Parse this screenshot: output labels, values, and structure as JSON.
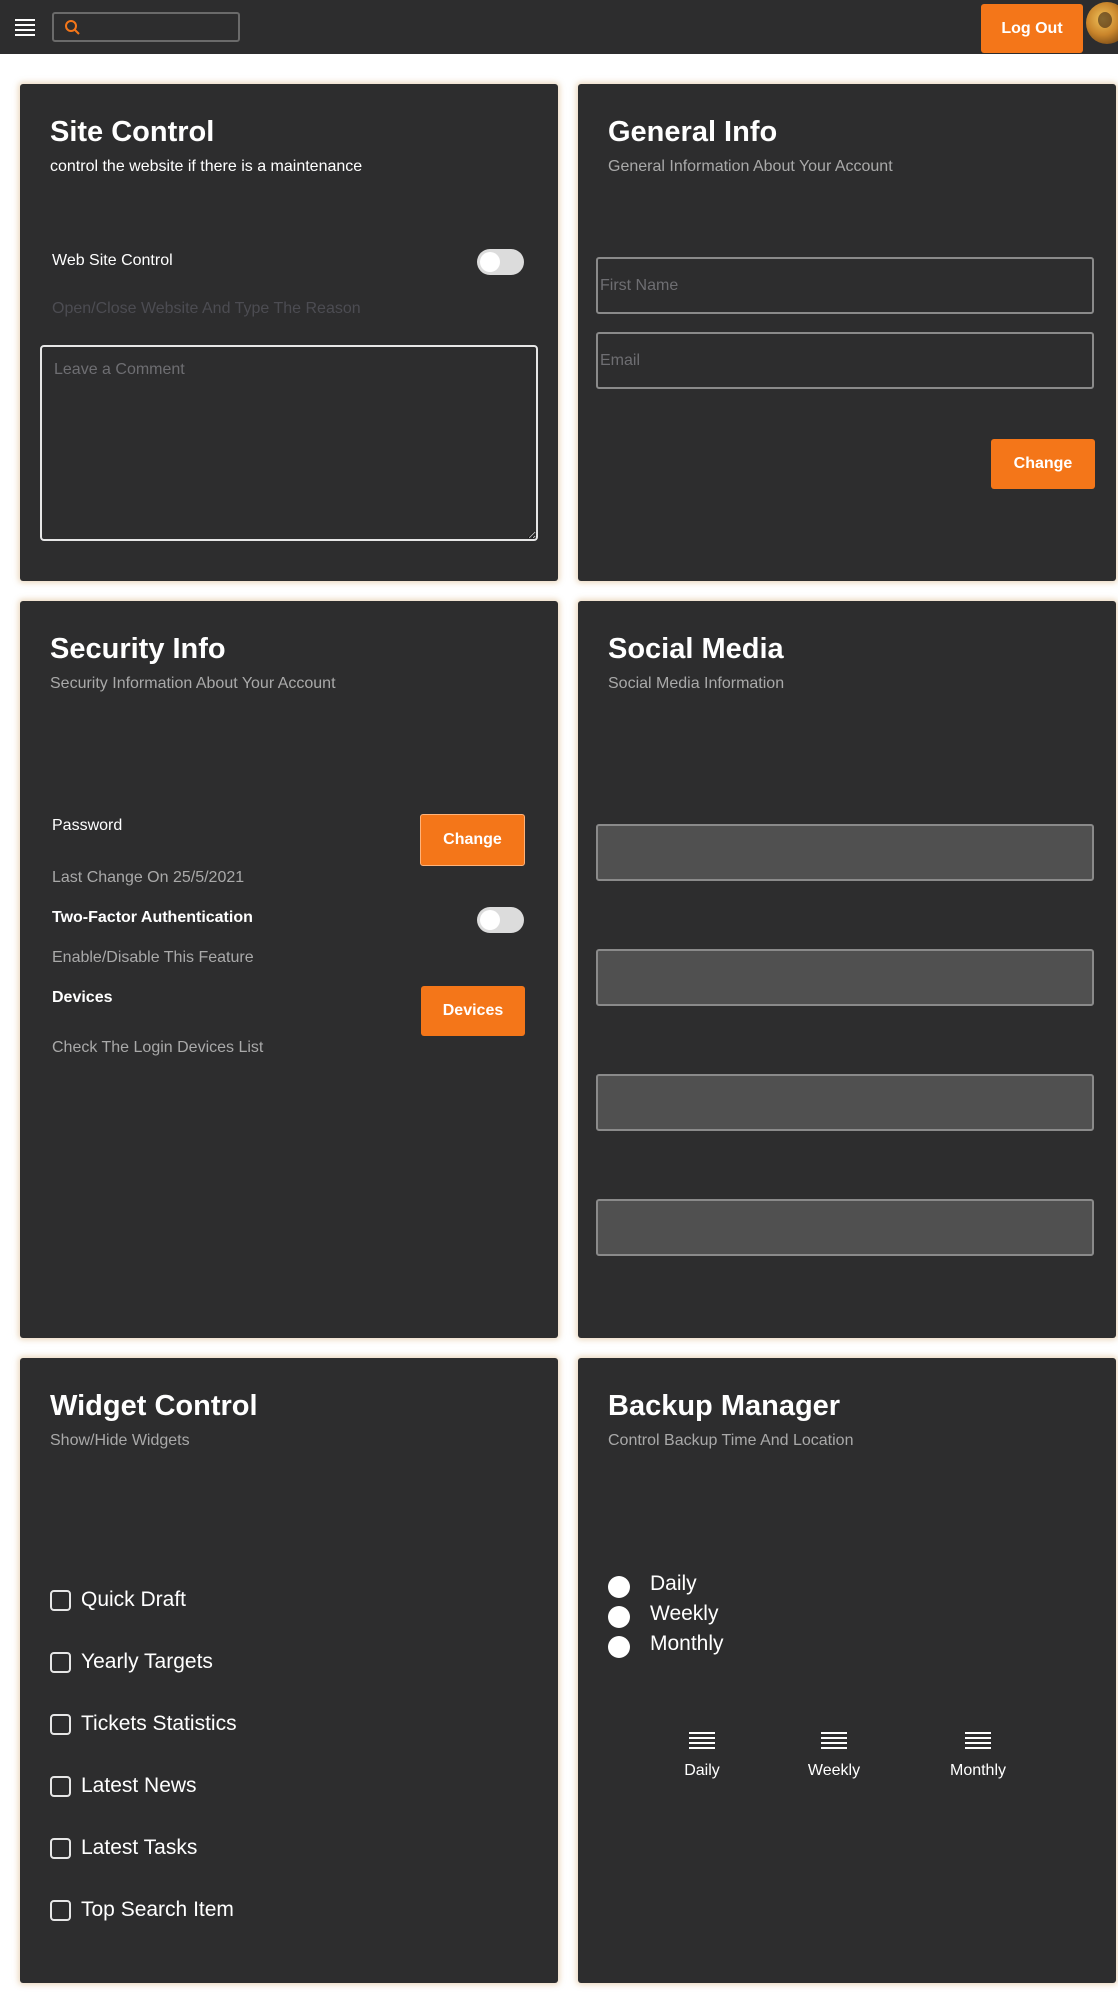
{
  "topbar": {
    "search_placeholder": "",
    "logout_label": "Log Out"
  },
  "site_control": {
    "title": "Site Control",
    "subtitle": "control the website if there is a maintenance",
    "toggle_label": "Web Site Control",
    "toggle_hint": "Open/Close Website And Type The Reason",
    "comment_placeholder": "Leave a Comment"
  },
  "general_info": {
    "title": "General Info",
    "subtitle": "General Information About Your Account",
    "first_name_placeholder": "First Name",
    "email_placeholder": "Email",
    "change_label": "Change"
  },
  "security_info": {
    "title": "Security Info",
    "subtitle": "Security Information About Your Account",
    "password_label": "Password",
    "password_hint": "Last Change On 25/5/2021",
    "change_label": "Change",
    "two_factor_label": "Two-Factor Authentication",
    "two_factor_hint": "Enable/Disable This Feature",
    "devices_label": "Devices",
    "devices_hint": "Check The Login Devices List",
    "devices_button": "Devices"
  },
  "social_media": {
    "title": "Social Media",
    "subtitle": "Social Media Information"
  },
  "widget_control": {
    "title": "Widget Control",
    "subtitle": "Show/Hide Widgets",
    "items": [
      "Quick Draft",
      "Yearly Targets",
      "Tickets Statistics",
      "Latest News",
      "Latest Tasks",
      "Top Search Item"
    ]
  },
  "backup_manager": {
    "title": "Backup Manager",
    "subtitle": "Control Backup Time And Location",
    "radio_options": [
      "Daily",
      "Weekly",
      "Monthly"
    ],
    "schedule_options": [
      "Daily",
      "Weekly",
      "Monthly"
    ]
  },
  "colors": {
    "accent": "#f47619",
    "card_bg": "#2d2d2e",
    "muted_text": "#a9a9a9"
  },
  "icons": [
    "menu-icon",
    "search-icon",
    "list-icon"
  ]
}
